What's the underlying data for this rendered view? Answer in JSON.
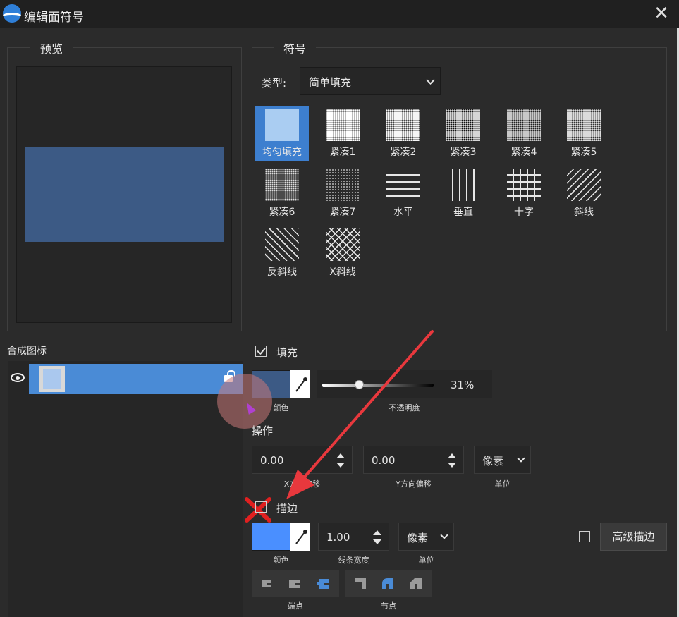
{
  "window": {
    "title": "编辑面符号",
    "close_glyph": "✕"
  },
  "preview": {
    "title": "预览",
    "fill_color": "#3c5a85"
  },
  "symbol": {
    "title": "符号",
    "type_label": "类型:",
    "type_value": "简单填充",
    "patterns": [
      {
        "name": "均匀填充",
        "selected": true
      },
      {
        "name": "紧凑1"
      },
      {
        "name": "紧凑2"
      },
      {
        "name": "紧凑3"
      },
      {
        "name": "紧凑4"
      },
      {
        "name": "紧凑5"
      },
      {
        "name": "紧凑6"
      },
      {
        "name": "紧凑7"
      },
      {
        "name": "水平"
      },
      {
        "name": "垂直"
      },
      {
        "name": "十字"
      },
      {
        "name": "斜线"
      },
      {
        "name": "反斜线"
      },
      {
        "name": "X斜线"
      }
    ]
  },
  "layers": {
    "title": "合成图标"
  },
  "fill": {
    "label": "填充",
    "checked": true,
    "color": "#3c5a85",
    "color_caption": "颜色",
    "opacity_value": "31%",
    "opacity_fraction": 0.31,
    "opacity_caption": "不透明度"
  },
  "operation": {
    "label": "操作",
    "x_offset": "0.00",
    "x_caption": "X方向偏移",
    "y_offset": "0.00",
    "y_caption": "Y方向偏移",
    "unit_value": "像素",
    "unit_caption": "单位"
  },
  "stroke": {
    "label": "描边",
    "checked": false,
    "color": "#4a8fff",
    "color_caption": "颜色",
    "width_value": "1.00",
    "width_caption": "线条宽度",
    "unit_value": "像素",
    "unit_caption": "单位",
    "advanced_label": "高级描边",
    "endpoint_caption": "端点",
    "node_caption": "节点"
  },
  "annotation": {
    "arrow_color": "#e8383d"
  }
}
